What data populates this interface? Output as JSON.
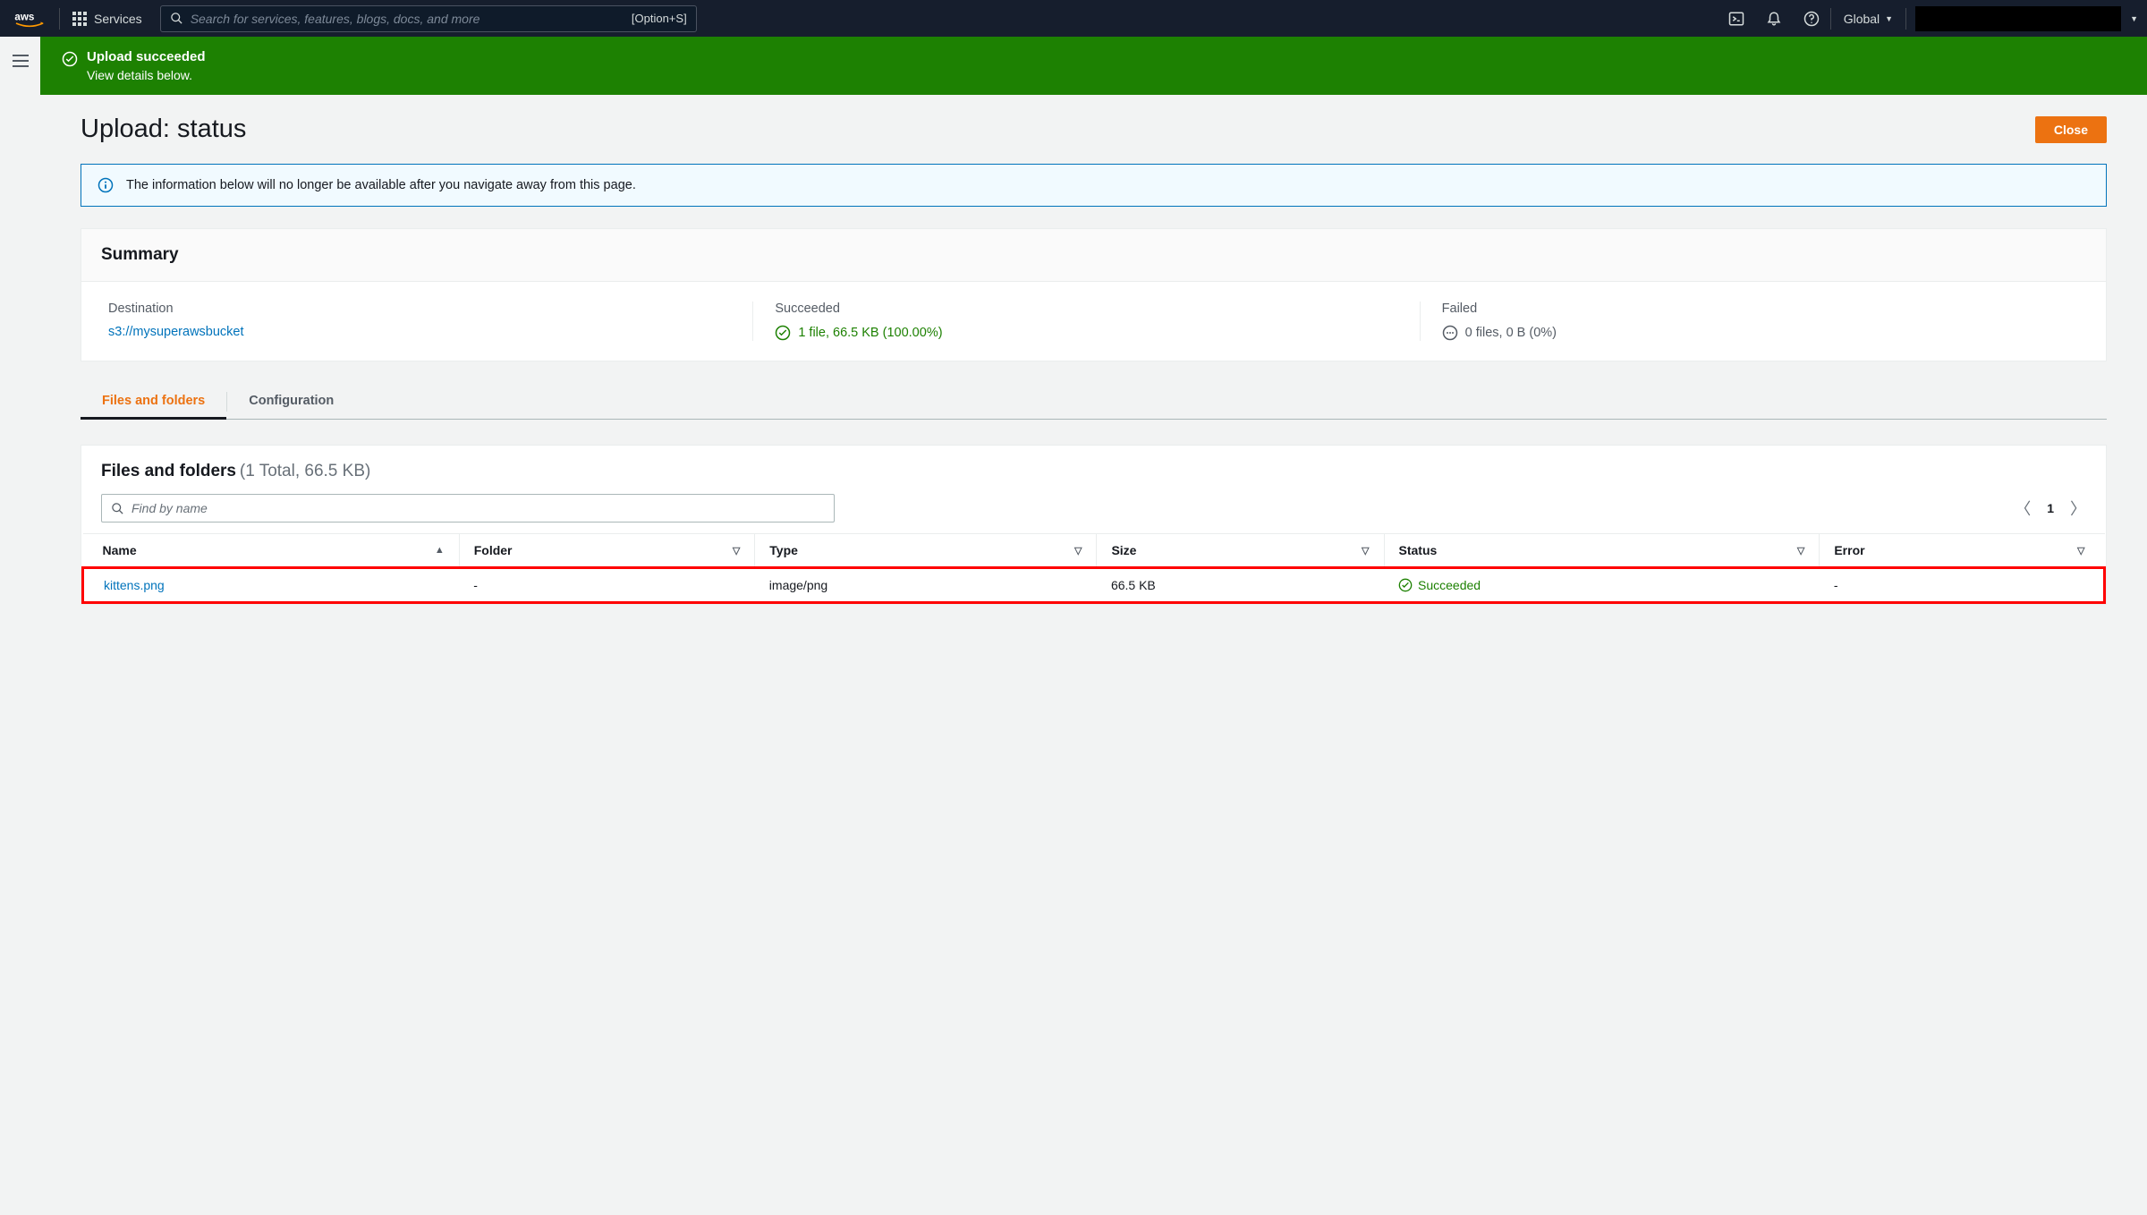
{
  "header": {
    "services_label": "Services",
    "search_placeholder": "Search for services, features, blogs, docs, and more",
    "search_hint": "[Option+S]",
    "region": "Global"
  },
  "banner": {
    "title": "Upload succeeded",
    "subtitle": "View details below."
  },
  "page": {
    "title": "Upload: status",
    "close_label": "Close"
  },
  "info_alert": {
    "text": "The information below will no longer be available after you navigate away from this page."
  },
  "summary": {
    "heading": "Summary",
    "destination_label": "Destination",
    "destination_value": "s3://mysuperawsbucket",
    "succeeded_label": "Succeeded",
    "succeeded_value": "1 file, 66.5 KB (100.00%)",
    "failed_label": "Failed",
    "failed_value": "0 files, 0 B (0%)"
  },
  "tabs": {
    "files": "Files and folders",
    "config": "Configuration"
  },
  "files_section": {
    "title": "Files and folders",
    "count_text": "(1 Total, 66.5 KB)",
    "find_placeholder": "Find by name",
    "page_current": "1",
    "columns": {
      "name": "Name",
      "folder": "Folder",
      "type": "Type",
      "size": "Size",
      "status": "Status",
      "error": "Error"
    },
    "rows": [
      {
        "name": "kittens.png",
        "folder": "-",
        "type": "image/png",
        "size": "66.5 KB",
        "status": "Succeeded",
        "error": "-"
      }
    ]
  }
}
